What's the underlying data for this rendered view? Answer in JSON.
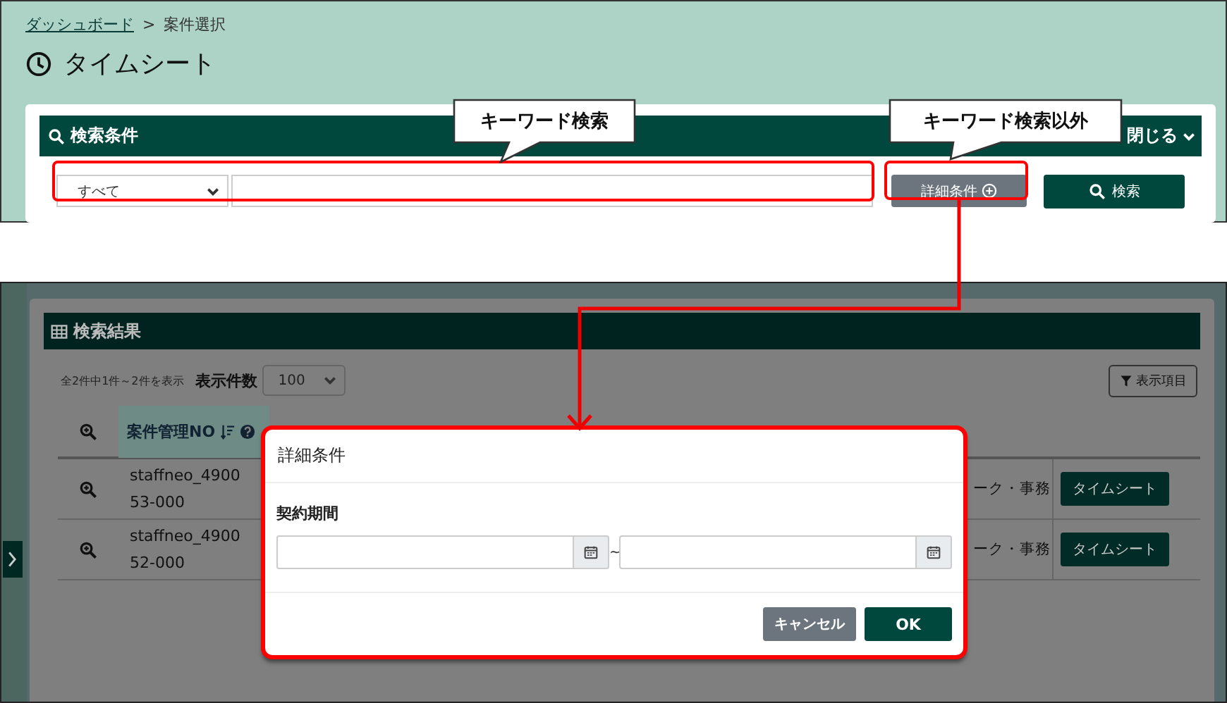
{
  "breadcrumb": [
    {
      "label": "ダッシュボード",
      "kind": "link"
    },
    {
      "label": ">",
      "kind": "separator"
    },
    {
      "label": "案件選択",
      "kind": "current"
    }
  ],
  "page_title": "タイムシート",
  "search_panel": {
    "title": "検索条件",
    "toggle": "閉じる",
    "scope_select": "すべて",
    "detail_button": "詳細条件",
    "search_button": "検索"
  },
  "results_panel": {
    "title": "検索結果",
    "summary": "全2件中1件～2件を表示",
    "page_size_label": "表示件数",
    "page_size": "100",
    "columns_button": "表示項目",
    "columns": [
      {
        "label": "案件管理NO",
        "sorted": true
      }
    ],
    "rows": [
      {
        "project_no": [
          "staffneo_4900",
          "53-000"
        ],
        "column_5": "ーク・事務",
        "action": "タイムシート"
      },
      {
        "project_no": [
          "staffneo_4900",
          "52-000"
        ],
        "column_5": "ーク・事務",
        "action": "タイムシート"
      }
    ]
  },
  "modal": {
    "title": "詳細条件",
    "field_label": "契約期間",
    "range_separator": "~",
    "buttons": [
      {
        "label": "キャンセル",
        "kind": "secondary"
      },
      {
        "label": "OK",
        "kind": "primary"
      }
    ]
  },
  "annotations": [
    {
      "text": "キーワード検索"
    },
    {
      "text": "キーワード検索以外"
    }
  ]
}
